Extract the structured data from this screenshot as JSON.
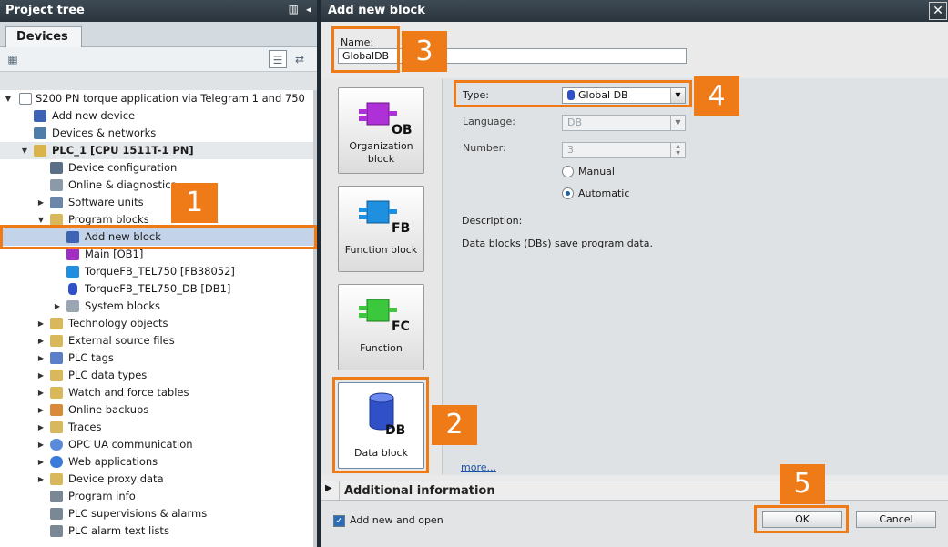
{
  "tree": {
    "header": "Project tree",
    "tab": "Devices",
    "items": [
      {
        "label": "S200 PN torque application via Telegram 1 and 750"
      },
      {
        "label": "Add new device"
      },
      {
        "label": "Devices & networks"
      },
      {
        "label": "PLC_1 [CPU 1511T-1 PN]"
      },
      {
        "label": "Device configuration"
      },
      {
        "label": "Online & diagnostics"
      },
      {
        "label": "Software units"
      },
      {
        "label": "Program blocks"
      },
      {
        "label": "Add new block"
      },
      {
        "label": "Main [OB1]"
      },
      {
        "label": "TorqueFB_TEL750 [FB38052]"
      },
      {
        "label": "TorqueFB_TEL750_DB [DB1]"
      },
      {
        "label": "System blocks"
      },
      {
        "label": "Technology objects"
      },
      {
        "label": "External source files"
      },
      {
        "label": "PLC tags"
      },
      {
        "label": "PLC data types"
      },
      {
        "label": "Watch and force tables"
      },
      {
        "label": "Online backups"
      },
      {
        "label": "Traces"
      },
      {
        "label": "OPC UA communication"
      },
      {
        "label": "Web applications"
      },
      {
        "label": "Device proxy data"
      },
      {
        "label": "Program info"
      },
      {
        "label": "PLC supervisions & alarms"
      },
      {
        "label": "PLC alarm text lists"
      }
    ]
  },
  "dialog": {
    "title": "Add new block",
    "close": "✕",
    "name_label": "Name:",
    "name_value": "GlobalDB",
    "blocks": [
      {
        "label": "Organization block",
        "code": "OB"
      },
      {
        "label": "Function block",
        "code": "FB"
      },
      {
        "label": "Function",
        "code": "FC"
      },
      {
        "label": "Data block",
        "code": "DB"
      }
    ],
    "type_label": "Type:",
    "type_value": "Global DB",
    "language_label": "Language:",
    "language_value": "DB",
    "number_label": "Number:",
    "number_value": "3",
    "radio_manual": "Manual",
    "radio_automatic": "Automatic",
    "description_label": "Description:",
    "description_text": "Data blocks (DBs) save program data.",
    "more": "more...",
    "additional_info": "Additional information",
    "add_and_open": "Add new and open",
    "ok": "OK",
    "cancel": "Cancel"
  },
  "callouts": [
    "1",
    "2",
    "3",
    "4",
    "5"
  ],
  "colors": {
    "accent": "#ee7a18",
    "title_bar": "#2f3a43",
    "selection": "#c3d4ea"
  },
  "icons": [
    "folder-icon",
    "cpu-icon",
    "block-icon",
    "db-cylinder-icon"
  ]
}
